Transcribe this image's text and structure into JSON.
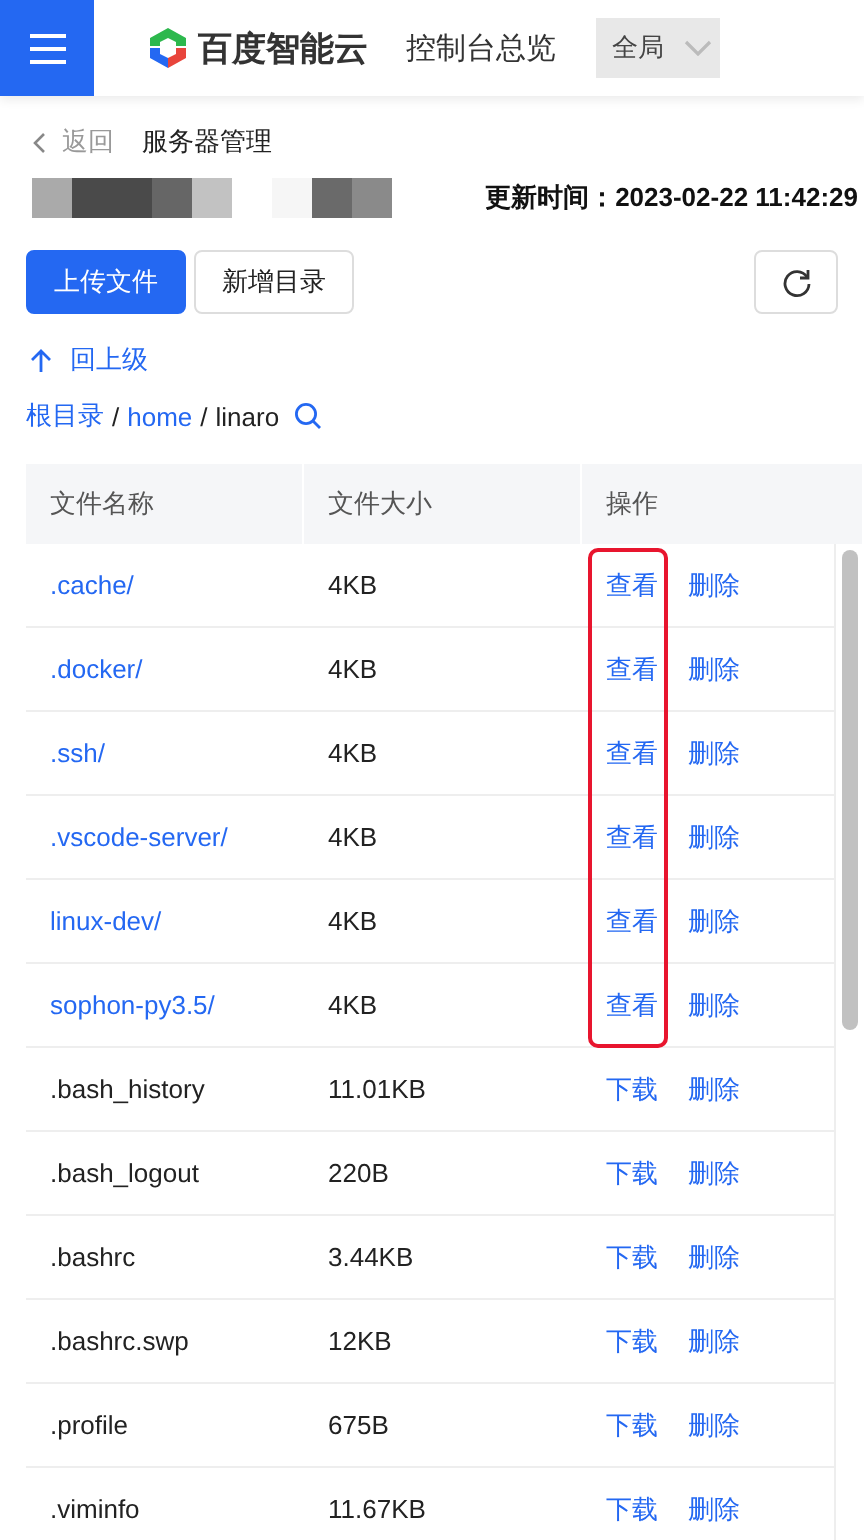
{
  "header": {
    "brand": "百度智能云",
    "nav_title": "控制台总览",
    "region_select": {
      "value": "全局"
    }
  },
  "breadcrumb": {
    "back": "返回",
    "title": "服务器管理"
  },
  "update_time": {
    "label": "更新时间：",
    "value": "2023-02-22 11:42:29"
  },
  "toolbar": {
    "buttons": [
      {
        "label": "上传文件",
        "kind": "primary"
      },
      {
        "label": "新增目录",
        "kind": "default"
      }
    ]
  },
  "up_level": "回上级",
  "path": [
    {
      "label": "根目录",
      "kind": "link"
    },
    {
      "label": "/",
      "kind": "separator"
    },
    {
      "label": "home",
      "kind": "link"
    },
    {
      "label": "/",
      "kind": "separator"
    },
    {
      "label": "linaro",
      "kind": "current"
    }
  ],
  "table": {
    "columns": [
      "文件名称",
      "文件大小",
      "操作"
    ],
    "rows": [
      {
        "name": ".cache/",
        "size": "4KB",
        "kind": "folder",
        "actions": [
          "查看",
          "删除"
        ],
        "highlighted": true
      },
      {
        "name": ".docker/",
        "size": "4KB",
        "kind": "folder",
        "actions": [
          "查看",
          "删除"
        ],
        "highlighted": true
      },
      {
        "name": ".ssh/",
        "size": "4KB",
        "kind": "folder",
        "actions": [
          "查看",
          "删除"
        ],
        "highlighted": true
      },
      {
        "name": ".vscode-server/",
        "size": "4KB",
        "kind": "folder",
        "actions": [
          "查看",
          "删除"
        ],
        "highlighted": true
      },
      {
        "name": "linux-dev/",
        "size": "4KB",
        "kind": "folder",
        "actions": [
          "查看",
          "删除"
        ],
        "highlighted": true
      },
      {
        "name": "sophon-py3.5/",
        "size": "4KB",
        "kind": "folder",
        "actions": [
          "查看",
          "删除"
        ],
        "highlighted": true
      },
      {
        "name": ".bash_history",
        "size": "11.01KB",
        "kind": "file",
        "actions": [
          "下载",
          "删除"
        ],
        "highlighted": false
      },
      {
        "name": ".bash_logout",
        "size": "220B",
        "kind": "file",
        "actions": [
          "下载",
          "删除"
        ],
        "highlighted": false
      },
      {
        "name": ".bashrc",
        "size": "3.44KB",
        "kind": "file",
        "actions": [
          "下载",
          "删除"
        ],
        "highlighted": false
      },
      {
        "name": ".bashrc.swp",
        "size": "12KB",
        "kind": "file",
        "actions": [
          "下载",
          "删除"
        ],
        "highlighted": false
      },
      {
        "name": ".profile",
        "size": "675B",
        "kind": "file",
        "actions": [
          "下载",
          "删除"
        ],
        "highlighted": false
      },
      {
        "name": ".viminfo",
        "size": "11.67KB",
        "kind": "file",
        "actions": [
          "下载",
          "删除"
        ],
        "highlighted": false
      }
    ]
  }
}
